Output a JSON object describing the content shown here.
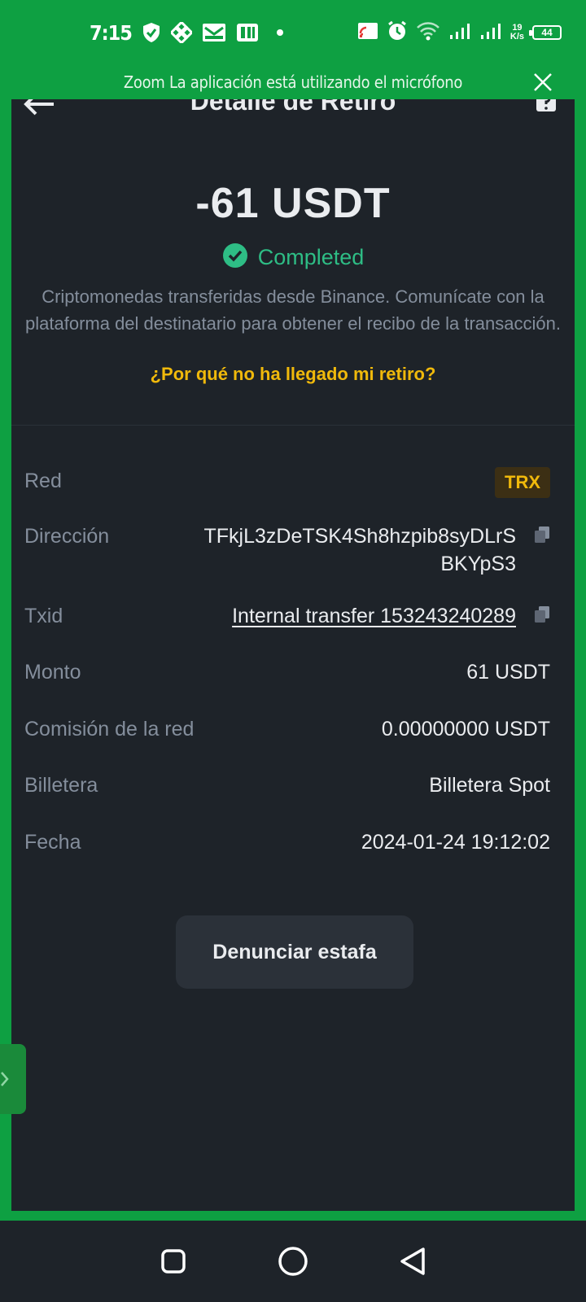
{
  "status_bar": {
    "time": "7:15",
    "net_speed_value": "19",
    "net_speed_unit": "K/s",
    "battery": "44"
  },
  "banner": {
    "text": "Zoom La aplicación está utilizando el micrófono"
  },
  "header": {
    "title": "Detalle de Retiro"
  },
  "summary": {
    "amount": "-61 USDT",
    "status": "Completed",
    "description": "Criptomonedas transferidas desde Binance. Comunícate con la plataforma del destinatario para obtener el recibo de la transacción.",
    "why_link": "¿Por qué no ha llegado mi retiro?"
  },
  "details": {
    "network_label": "Red",
    "network_value": "TRX",
    "address_label": "Dirección",
    "address_value": "TFkjL3zDeTSK4Sh8hzpib8syDLrSBKYpS3",
    "txid_label": "Txid",
    "txid_value": "Internal transfer 153243240289",
    "amount_label": "Monto",
    "amount_value": "61 USDT",
    "fee_label": "Comisión de la red",
    "fee_value": "0.00000000 USDT",
    "wallet_label": "Billetera",
    "wallet_value": "Billetera Spot",
    "date_label": "Fecha",
    "date_value": "2024-01-24 19:12:02"
  },
  "actions": {
    "report_label": "Denunciar estafa"
  },
  "colors": {
    "background": "#1e2329",
    "frame_green": "#0ea042",
    "success": "#2ebd85",
    "accent": "#f0b90b",
    "text_primary": "#eaecef",
    "text_secondary": "#848e9c"
  }
}
